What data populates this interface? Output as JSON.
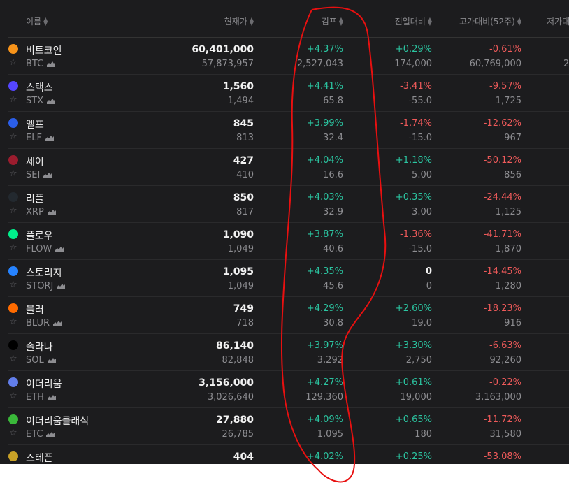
{
  "header": {
    "name": "이름",
    "price": "현재가",
    "kimp": "김프",
    "change": "전일대비",
    "high52": "고가대비(52주)",
    "low52": "저가대"
  },
  "rows": [
    {
      "name": "비트코인",
      "symbol": "BTC",
      "price": "60,401,000",
      "price_sub": "57,873,957",
      "kimp": "+4.37%",
      "kimp_sub": "2,527,043",
      "chg": "+0.29%",
      "chg_sub": "174,000",
      "high": "-0.61%",
      "high_sub": "60,769,000",
      "low_sub": "2",
      "icon": "bitcoin-icon",
      "color": "#f7931a"
    },
    {
      "name": "스택스",
      "symbol": "STX",
      "price": "1,560",
      "price_sub": "1,494",
      "kimp": "+4.41%",
      "kimp_sub": "65.8",
      "chg": "-3.41%",
      "chg_sub": "-55.0",
      "high": "-9.57%",
      "high_sub": "1,725",
      "icon": "stacks-icon",
      "color": "#5546ff"
    },
    {
      "name": "엘프",
      "symbol": "ELF",
      "price": "845",
      "price_sub": "813",
      "kimp": "+3.99%",
      "kimp_sub": "32.4",
      "chg": "-1.74%",
      "chg_sub": "-15.0",
      "high": "-12.62%",
      "high_sub": "967",
      "icon": "aelf-icon",
      "color": "#2b5ee8"
    },
    {
      "name": "세이",
      "symbol": "SEI",
      "price": "427",
      "price_sub": "410",
      "kimp": "+4.04%",
      "kimp_sub": "16.6",
      "chg": "+1.18%",
      "chg_sub": "5.00",
      "high": "-50.12%",
      "high_sub": "856",
      "icon": "sei-icon",
      "color": "#9b1c2e"
    },
    {
      "name": "리플",
      "symbol": "XRP",
      "price": "850",
      "price_sub": "817",
      "kimp": "+4.03%",
      "kimp_sub": "32.9",
      "chg": "+0.35%",
      "chg_sub": "3.00",
      "high": "-24.44%",
      "high_sub": "1,125",
      "icon": "xrp-icon",
      "color": "#23292f"
    },
    {
      "name": "플로우",
      "symbol": "FLOW",
      "price": "1,090",
      "price_sub": "1,049",
      "kimp": "+3.87%",
      "kimp_sub": "40.6",
      "chg": "-1.36%",
      "chg_sub": "-15.0",
      "high": "-41.71%",
      "high_sub": "1,870",
      "icon": "flow-icon",
      "color": "#00ef8b"
    },
    {
      "name": "스토리지",
      "symbol": "STORJ",
      "price": "1,095",
      "price_sub": "1,049",
      "kimp": "+4.35%",
      "kimp_sub": "45.6",
      "chg": "0",
      "chg_sub": "0",
      "high": "-14.45%",
      "high_sub": "1,280",
      "icon": "storj-icon",
      "color": "#2683ff"
    },
    {
      "name": "블러",
      "symbol": "BLUR",
      "price": "749",
      "price_sub": "718",
      "kimp": "+4.29%",
      "kimp_sub": "30.8",
      "chg": "+2.60%",
      "chg_sub": "19.0",
      "high": "-18.23%",
      "high_sub": "916",
      "icon": "blur-icon",
      "color": "#ff6b00"
    },
    {
      "name": "솔라나",
      "symbol": "SOL",
      "price": "86,140",
      "price_sub": "82,848",
      "kimp": "+3.97%",
      "kimp_sub": "3,292",
      "chg": "+3.30%",
      "chg_sub": "2,750",
      "high": "-6.63%",
      "high_sub": "92,260",
      "icon": "solana-icon",
      "color": "#000000"
    },
    {
      "name": "이더리움",
      "symbol": "ETH",
      "price": "3,156,000",
      "price_sub": "3,026,640",
      "kimp": "+4.27%",
      "kimp_sub": "129,360",
      "chg": "+0.61%",
      "chg_sub": "19,000",
      "high": "-0.22%",
      "high_sub": "3,163,000",
      "icon": "ethereum-icon",
      "color": "#627eea"
    },
    {
      "name": "이더리움클래식",
      "symbol": "ETC",
      "price": "27,880",
      "price_sub": "26,785",
      "kimp": "+4.09%",
      "kimp_sub": "1,095",
      "chg": "+0.65%",
      "chg_sub": "180",
      "high": "-11.72%",
      "high_sub": "31,580",
      "icon": "ethereum-classic-icon",
      "color": "#3ab83a"
    },
    {
      "name": "스테픈",
      "symbol": "",
      "price": "404",
      "price_sub": "",
      "kimp": "+4.02%",
      "kimp_sub": "",
      "chg": "+0.25%",
      "chg_sub": "",
      "high": "-53.08%",
      "high_sub": "",
      "icon": "stepn-icon",
      "color": "#c9a227"
    }
  ],
  "colors": {
    "positive": "#2bc5a1",
    "negative": "#ef5a5a",
    "annotation": "#e81010"
  }
}
